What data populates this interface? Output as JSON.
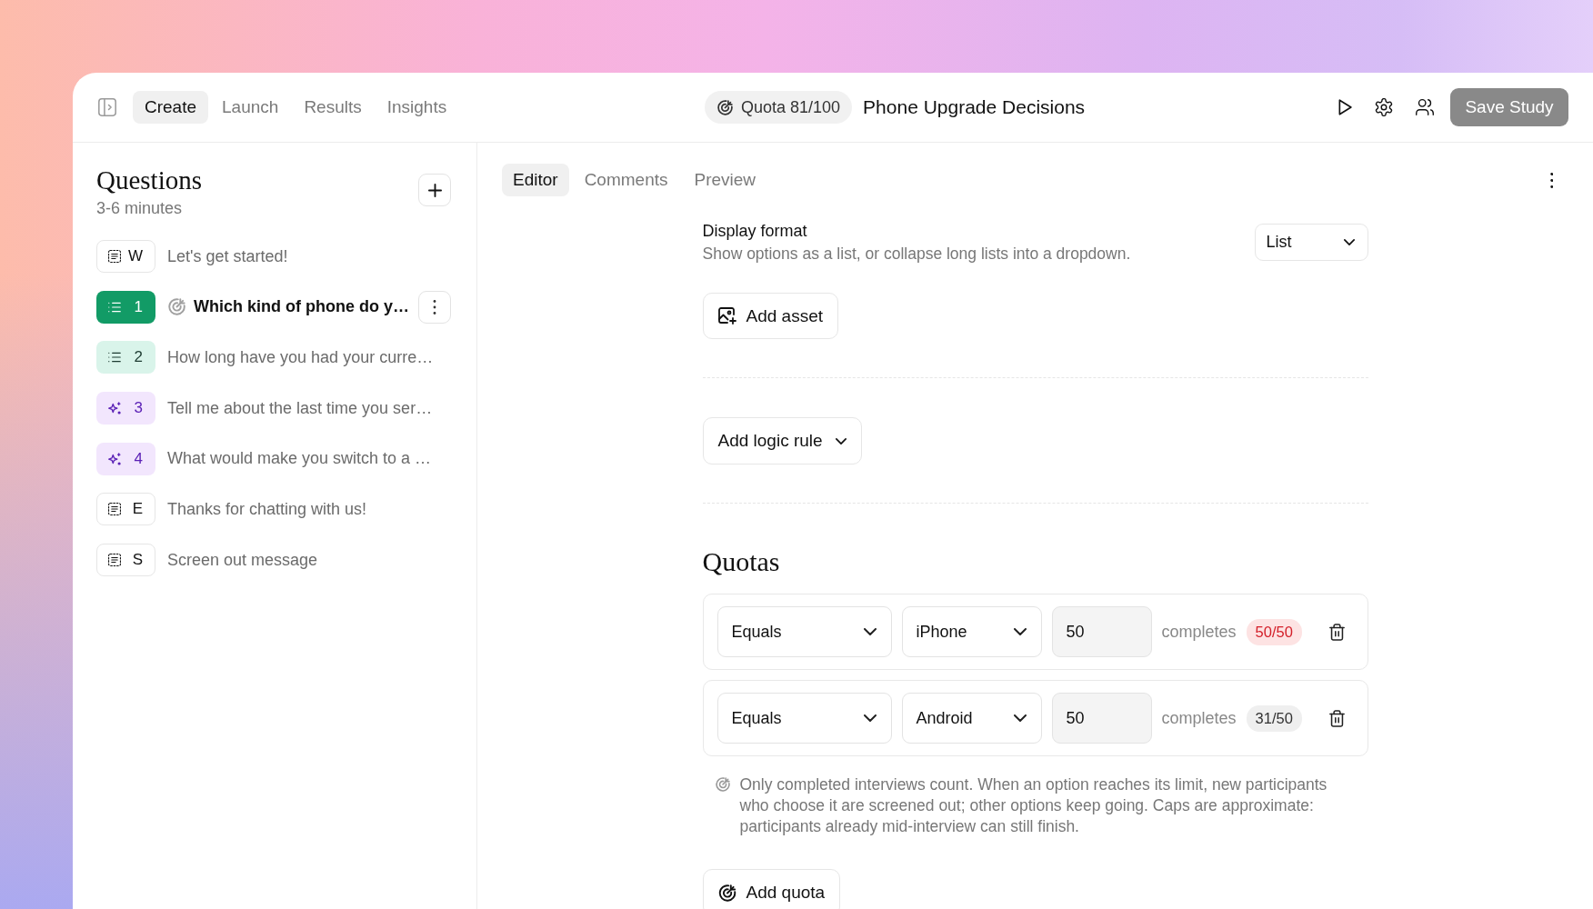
{
  "topbar": {
    "tabs": [
      {
        "label": "Create",
        "selected": true
      },
      {
        "label": "Launch",
        "selected": false
      },
      {
        "label": "Results",
        "selected": false
      },
      {
        "label": "Insights",
        "selected": false
      }
    ],
    "quota": "Quota 81/100",
    "title": "Phone Upgrade Decisions",
    "save_button": {
      "label": "Save Study",
      "disabled": true
    }
  },
  "sidebar": {
    "title": "Questions",
    "subtitle": "3-6 minutes",
    "questions": [
      {
        "kind": "static",
        "badge": "W",
        "text": "Let's get started!",
        "selected": false,
        "quota": false
      },
      {
        "kind": "choice",
        "badge": "1",
        "text": "Which kind of phone do y…",
        "selected": true,
        "quota": true
      },
      {
        "kind": "choice",
        "badge": "2",
        "text": "How long have you had your curre…",
        "selected": false,
        "quota": false
      },
      {
        "kind": "ai",
        "badge": "3",
        "text": "Tell me about the last time you ser…",
        "selected": false,
        "quota": false
      },
      {
        "kind": "ai",
        "badge": "4",
        "text": "What would make you switch to a …",
        "selected": false,
        "quota": false
      },
      {
        "kind": "static",
        "badge": "E",
        "text": "Thanks for chatting with us!",
        "selected": false,
        "quota": false
      },
      {
        "kind": "static",
        "badge": "S",
        "text": "Screen out message",
        "selected": false,
        "quota": false
      }
    ]
  },
  "editor": {
    "tabs": [
      {
        "label": "Editor",
        "selected": true
      },
      {
        "label": "Comments",
        "selected": false
      },
      {
        "label": "Preview",
        "selected": false
      }
    ],
    "display_format": {
      "label": "Display format",
      "description": "Show options as a list, or collapse long lists into a dropdown.",
      "value": "List"
    },
    "add_asset": "Add asset",
    "add_logic_rule": "Add logic rule",
    "quotas": {
      "title": "Quotas",
      "rows": [
        {
          "operator": "Equals",
          "option": "iPhone",
          "limit": "50",
          "unit": "completes",
          "progress": "50/50",
          "full": true
        },
        {
          "operator": "Equals",
          "option": "Android",
          "limit": "50",
          "unit": "completes",
          "progress": "31/50",
          "full": false
        }
      ],
      "note": "Only completed interviews count. When an option reaches its limit, new participants who choose it are screened out; other options keep going. Caps are approximate: participants already mid-interview can still finish.",
      "add_button": "Add quota"
    }
  }
}
